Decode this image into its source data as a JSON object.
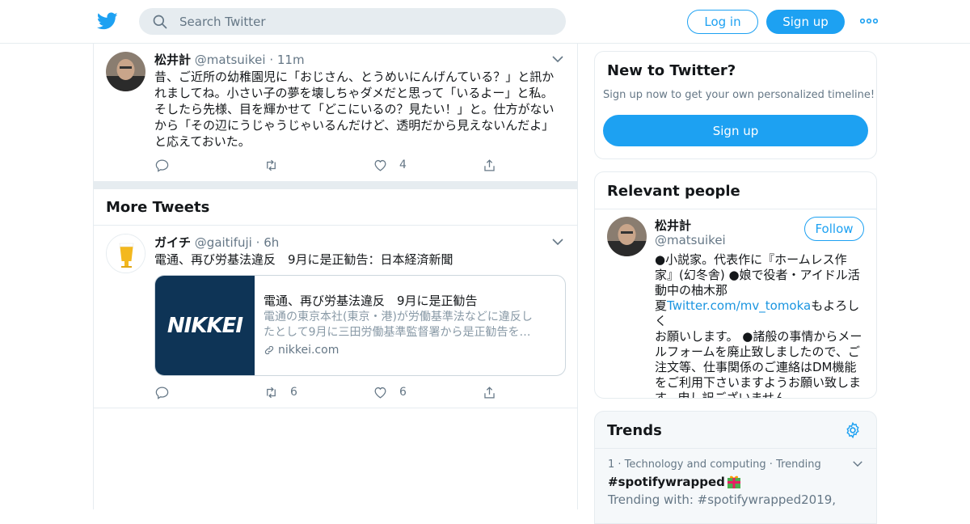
{
  "header": {
    "search_placeholder": "Search Twitter",
    "login_label": "Log in",
    "signup_label": "Sign up",
    "icons": [
      "twitter-logo",
      "search-icon",
      "more-icon"
    ]
  },
  "tweet1": {
    "name": "松井計",
    "handle": "@matsuikei",
    "time": "11m",
    "lines": [
      "昔、ご近所の幼稚園児に「おじさん、とうめいにんげんている？」と訊か",
      "れましてね。小さい子の夢を壊しちゃダメだと思って「いるよー」と私。",
      "そしたら先様、目を輝かせて「どこにいるの？見たい！」と。仕方がない",
      "から「その辺にうじゃうじゃいるんだけど、透明だから見えないんだよ」",
      "と応えておいた。"
    ],
    "likes": "4"
  },
  "more_tweets": {
    "title": "More Tweets"
  },
  "tweet2": {
    "name": "ガイチ",
    "handle": "@gaitifuji",
    "time": "6h",
    "text": "電通、再び労基法違反　9月に是正勧告：日本経済新聞",
    "card": {
      "image_text": "NIKKEI",
      "title": "電通、再び労基法違反　9月に是正勧告",
      "desc_lines": [
        "電通の東京本社(東京・港)が労働基準法などに違反し",
        "たとして9月に三田労働基準監督署から是正勧告を…"
      ],
      "domain": "nikkei.com"
    },
    "retweets": "6",
    "likes": "6"
  },
  "sidebar": {
    "new_title": "New to Twitter?",
    "new_sub": "Sign up now to get your own personalized timeline!",
    "new_button": "Sign up",
    "relevant_title": "Relevant people",
    "person": {
      "name": "松井計",
      "handle": "@matsuikei",
      "follow": "Follow",
      "bio_lines": [
        "●小説家。代表作に『ホームレス作",
        "家』(幻冬舎) ●娘で役者・アイドル活",
        "動中の柚木那"
      ],
      "bio_link_prefix": "夏",
      "bio_link": "Twitter.com/mv_tomoka",
      "bio_link_suffix": "もよろしく",
      "bio_rest": [
        "お願いします。 ●諸般の事情からメー",
        "ルフォームを廃止致しましたので、ご",
        "注文等、仕事関係のご連絡はDM機能",
        "をご利用下さいますようお願い致しま",
        "す。申し訳ございません。"
      ]
    },
    "trends_title": "Trends",
    "trend1": {
      "meta": "1 · Technology and computing · Trending",
      "tag": "#spotifywrapped",
      "with": "Trending with: #spotifywrapped2019,"
    }
  },
  "colors": {
    "accent": "#1da1f2",
    "nikkei": "#0e3456",
    "divider": "#e6ecf0"
  }
}
